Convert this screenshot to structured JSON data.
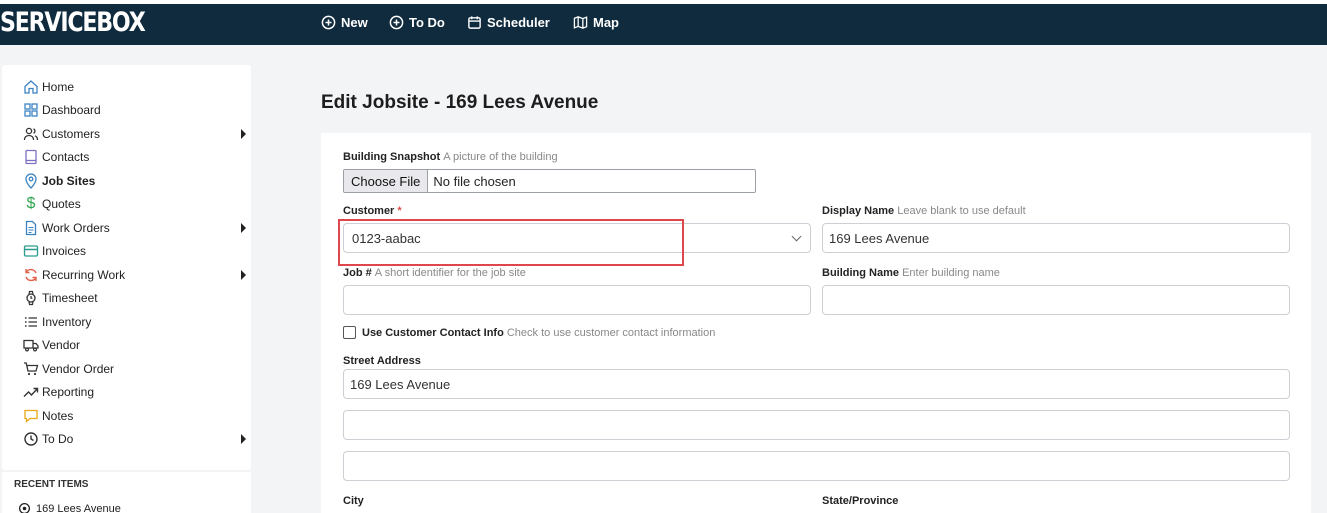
{
  "app": {
    "brand": "SERVICEBOX"
  },
  "topnav": [
    {
      "label": "New",
      "icon": "plus-circle-icon"
    },
    {
      "label": "To Do",
      "icon": "plus-circle-icon"
    },
    {
      "label": "Scheduler",
      "icon": "calendar-icon"
    },
    {
      "label": "Map",
      "icon": "map-icon"
    }
  ],
  "sidebar": {
    "items": [
      {
        "label": "Home",
        "icon": "home-icon"
      },
      {
        "label": "Dashboard",
        "icon": "grid-icon"
      },
      {
        "label": "Customers",
        "icon": "users-icon",
        "has_submenu": true
      },
      {
        "label": "Contacts",
        "icon": "book-icon"
      },
      {
        "label": "Job Sites",
        "icon": "location-pin-icon",
        "active": true
      },
      {
        "label": "Quotes",
        "icon": "dollar-icon"
      },
      {
        "label": "Work Orders",
        "icon": "document-icon",
        "has_submenu": true
      },
      {
        "label": "Invoices",
        "icon": "credit-card-icon"
      },
      {
        "label": "Recurring Work",
        "icon": "refresh-icon",
        "has_submenu": true
      },
      {
        "label": "Timesheet",
        "icon": "watch-icon"
      },
      {
        "label": "Inventory",
        "icon": "list-icon"
      },
      {
        "label": "Vendor",
        "icon": "truck-icon"
      },
      {
        "label": "Vendor Order",
        "icon": "cart-icon"
      },
      {
        "label": "Reporting",
        "icon": "trend-icon"
      },
      {
        "label": "Notes",
        "icon": "note-icon"
      },
      {
        "label": "To Do",
        "icon": "clock-icon",
        "has_submenu": true
      }
    ],
    "recent_title": "RECENT ITEMS",
    "recent_items": [
      {
        "label": "169 Lees Avenue",
        "icon": "location-target-icon"
      }
    ]
  },
  "page": {
    "title": "Edit Jobsite - 169 Lees Avenue"
  },
  "form": {
    "snapshot": {
      "label": "Building Snapshot",
      "hint": "A picture of the building",
      "button": "Choose File",
      "status": "No file chosen"
    },
    "customer": {
      "label": "Customer",
      "required_mark": "*",
      "value": "0123-aabac"
    },
    "display_name": {
      "label": "Display Name",
      "hint": "Leave blank to use default",
      "value": "169 Lees Avenue"
    },
    "job_number": {
      "label": "Job #",
      "hint": "A short identifier for the job site",
      "value": ""
    },
    "building_name": {
      "label": "Building Name",
      "hint": "Enter building name",
      "value": ""
    },
    "use_contact": {
      "label": "Use Customer Contact Info",
      "hint": "Check to use customer contact information",
      "checked": false
    },
    "street": {
      "label": "Street Address",
      "line1": "169 Lees Avenue",
      "line2": "",
      "line3": ""
    },
    "city": {
      "label": "City"
    },
    "state": {
      "label": "State/Province"
    }
  },
  "colors": {
    "nav_bg": "#0f2b3d",
    "highlight": "#e0474c",
    "required": "#d9534f"
  }
}
